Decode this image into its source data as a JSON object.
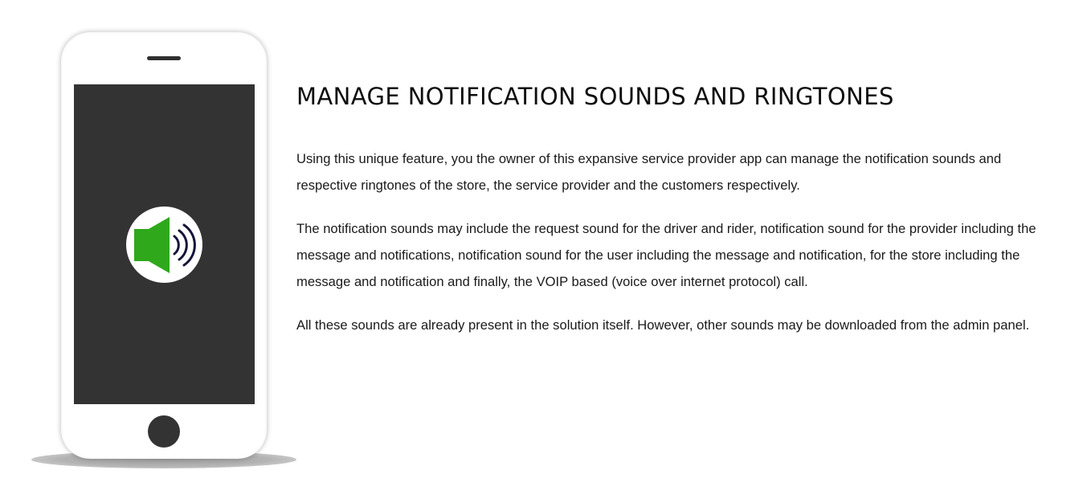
{
  "illustration": {
    "icon": "speaker-volume-icon",
    "colors": {
      "screen": "#333333",
      "speaker": "#2fa81c",
      "waves": "#15153a",
      "badge": "#ffffff"
    }
  },
  "section": {
    "title": "MANAGE NOTIFICATION SOUNDS AND RINGTONES",
    "paragraphs": [
      "Using this unique feature, you the owner of this expansive service provider app can manage the notification sounds and respective ringtones of the store, the service provider and the customers respectively.",
      "The notification sounds may include the request sound for the driver and rider, notification sound for the provider including the message and notifications, notification sound for the user including the message and notification, for the store including the message and notification and finally, the VOIP based (voice over internet protocol) call.",
      "All these sounds are already present in the solution itself. However, other sounds may be downloaded from the admin panel."
    ]
  }
}
